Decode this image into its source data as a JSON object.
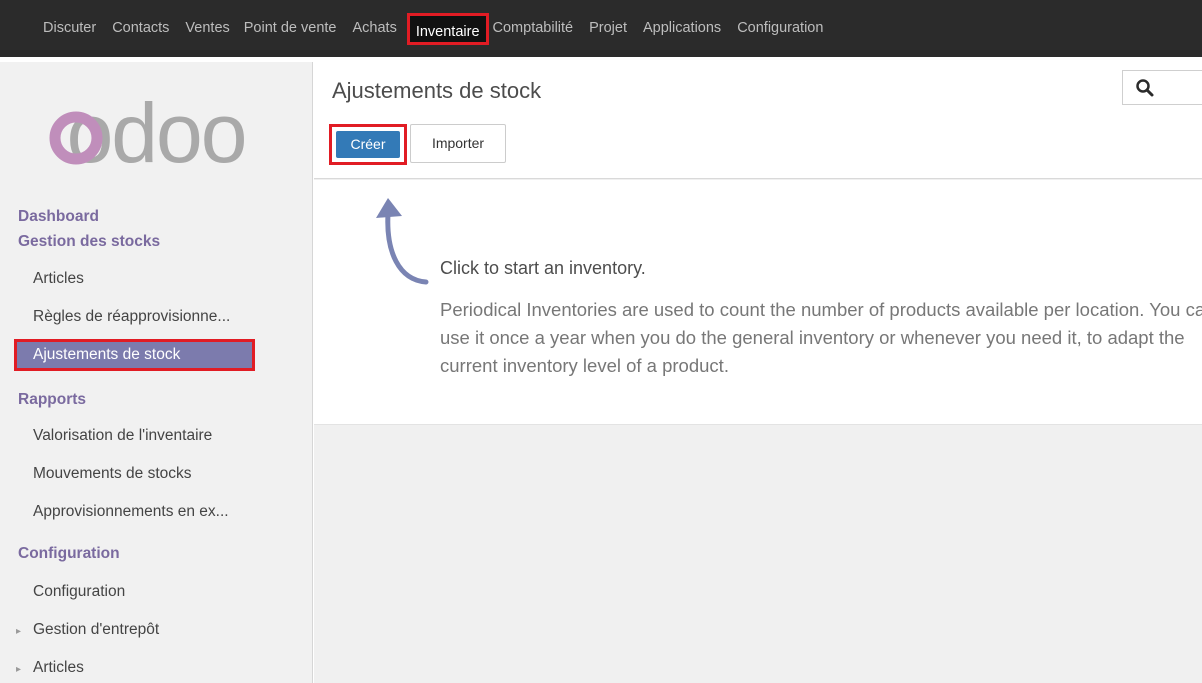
{
  "topnav": {
    "items": [
      {
        "label": "Discuter"
      },
      {
        "label": "Contacts"
      },
      {
        "label": "Ventes"
      },
      {
        "label": "Point de vente"
      },
      {
        "label": "Achats"
      },
      {
        "label": "Inventaire"
      },
      {
        "label": "Comptabilité"
      },
      {
        "label": "Projet"
      },
      {
        "label": "Applications"
      },
      {
        "label": "Configuration"
      }
    ],
    "active": "Inventaire",
    "highlight_color": "#e11c24"
  },
  "logo": {
    "text": "odoo"
  },
  "sidebar": {
    "dashboard": "Dashboard",
    "stock_management": "Gestion des stocks",
    "articles": "Articles",
    "reorder_rules": "Règles de réapprovisionne...",
    "stock_adjustments": "Ajustements de stock",
    "reports": "Rapports",
    "inventory_valuation": "Valorisation de l'inventaire",
    "stock_moves": "Mouvements de stocks",
    "procurements": "Approvisionnements en ex...",
    "config_section": "Configuration",
    "config_item": "Configuration",
    "warehouse_mgmt": "Gestion d'entrepôt",
    "articles_sub": "Articles",
    "active_color": "#7c7bad"
  },
  "main": {
    "title": "Ajustements de stock",
    "create_label": "Créer",
    "import_label": "Importer",
    "help_title": "Click to start an inventory.",
    "help_text": "Periodical Inventories are used to count the number of products available per location. You can use it once a year when you do the general inventory or whenever you need it, to adapt the current inventory level of a product.",
    "primary_color": "#337ab7"
  }
}
